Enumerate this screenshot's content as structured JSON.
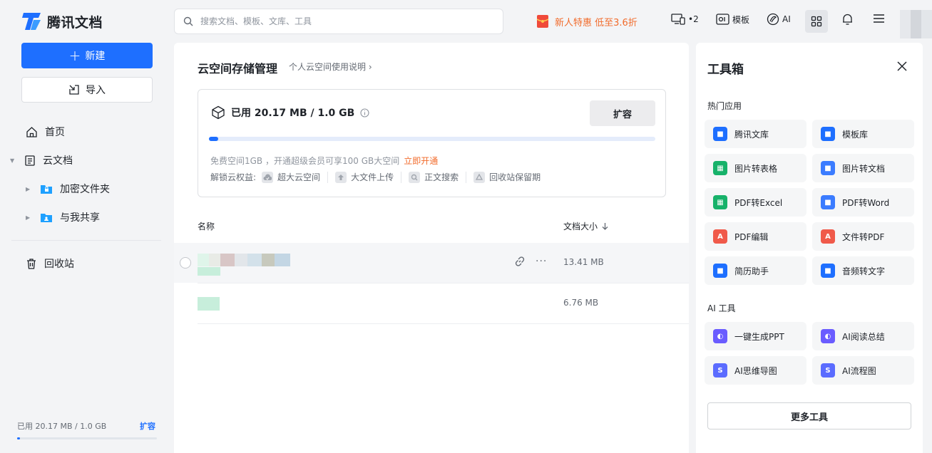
{
  "brand": {
    "name": "腾讯文档",
    "accent": "#1e6fff"
  },
  "sidebar": {
    "new_label": "新建",
    "import_label": "导入",
    "items": [
      {
        "label": "首页",
        "icon": "home-icon"
      },
      {
        "label": "云文档",
        "icon": "document-icon"
      },
      {
        "label": "加密文件夹",
        "icon": "locked-folder-icon"
      },
      {
        "label": "与我共享",
        "icon": "shared-folder-icon"
      },
      {
        "label": "回收站",
        "icon": "trash-icon"
      }
    ],
    "storage": {
      "text": "已用 20.17 MB / 1.0 GB",
      "expand_label": "扩容",
      "used_fraction": 0.02
    }
  },
  "topbar": {
    "search_placeholder": "搜索文档、模板、文库、工具",
    "promo": "新人特惠 低至3.6折",
    "device_count": "•2",
    "template_label": "模板",
    "ai_label": "AI"
  },
  "main": {
    "title": "云空间存储管理",
    "help_link": "个人云空间使用说明",
    "usage": "已用 20.17 MB / 1.0 GB",
    "used_fraction": 0.02,
    "expand_button": "扩容",
    "note": "免费空间1GB ，开通超级会员可享100 GB大空间",
    "note_link": "立即开通",
    "rights_label": "解锁云权益:",
    "rights": [
      "超大云空间",
      "大文件上传",
      "正文搜索",
      "回收站保留期"
    ],
    "table": {
      "col_name": "名称",
      "col_size": "文档大小",
      "rows": [
        {
          "size": "13.41 MB"
        },
        {
          "size": "6.76 MB"
        }
      ]
    }
  },
  "toolbox": {
    "title": "工具箱",
    "hot_section": "热门应用",
    "hot_tools": [
      {
        "label": "腾讯文库",
        "color": "#1e6fff"
      },
      {
        "label": "模板库",
        "color": "#1e6fff"
      },
      {
        "label": "图片转表格",
        "color": "#17b26a"
      },
      {
        "label": "图片转文档",
        "color": "#3b7cff"
      },
      {
        "label": "PDF转Excel",
        "color": "#17b26a"
      },
      {
        "label": "PDF转Word",
        "color": "#3b7cff"
      },
      {
        "label": "PDF编辑",
        "color": "#f05a4a"
      },
      {
        "label": "文件转PDF",
        "color": "#f05a4a"
      },
      {
        "label": "简历助手",
        "color": "#1e6fff"
      },
      {
        "label": "音频转文字",
        "color": "#1e6fff"
      }
    ],
    "ai_section": "AI 工具",
    "ai_tools": [
      {
        "label": "一键生成PPT",
        "color": "#6a5cff"
      },
      {
        "label": "AI阅读总结",
        "color": "#6a5cff"
      },
      {
        "label": "AI思维导图",
        "color": "#5b6cff"
      },
      {
        "label": "AI流程图",
        "color": "#5b6cff"
      }
    ],
    "more_label": "更多工具"
  }
}
